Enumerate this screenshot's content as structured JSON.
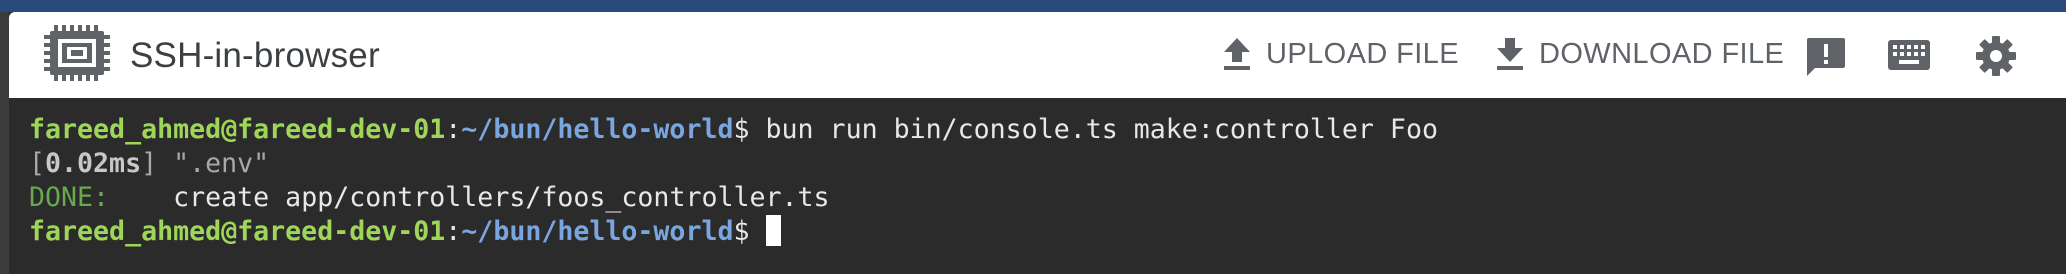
{
  "titlebar": {
    "title": "SSH-in-browser",
    "upload_label": "UPLOAD FILE",
    "download_label": "DOWNLOAD FILE"
  },
  "icons": {
    "app": "chip-icon",
    "upload": "upload-icon",
    "download": "download-icon",
    "feedback": "feedback-icon",
    "keyboard": "keyboard-icon",
    "settings": "gear-icon"
  },
  "colors": {
    "top_strip": "#2a4a7c",
    "terminal_bg": "#2b2b2b",
    "prompt_user": "#9fd65a",
    "prompt_path": "#7aa6e0",
    "done": "#6aa84f"
  },
  "terminal": {
    "lines": [
      {
        "user": "fareed_ahmed@fareed-dev-01",
        "colon": ":",
        "path": "~/bun/hello-world",
        "dollar": "$",
        "command": " bun run bin/console.ts make:controller Foo"
      },
      {
        "open": "[",
        "time": "0.02ms",
        "rest": "] \".env\""
      },
      {
        "status": "DONE:",
        "message": "    create app/controllers/foos_controller.ts"
      },
      {
        "user": "fareed_ahmed@fareed-dev-01",
        "colon": ":",
        "path": "~/bun/hello-world",
        "dollar": "$"
      }
    ]
  }
}
